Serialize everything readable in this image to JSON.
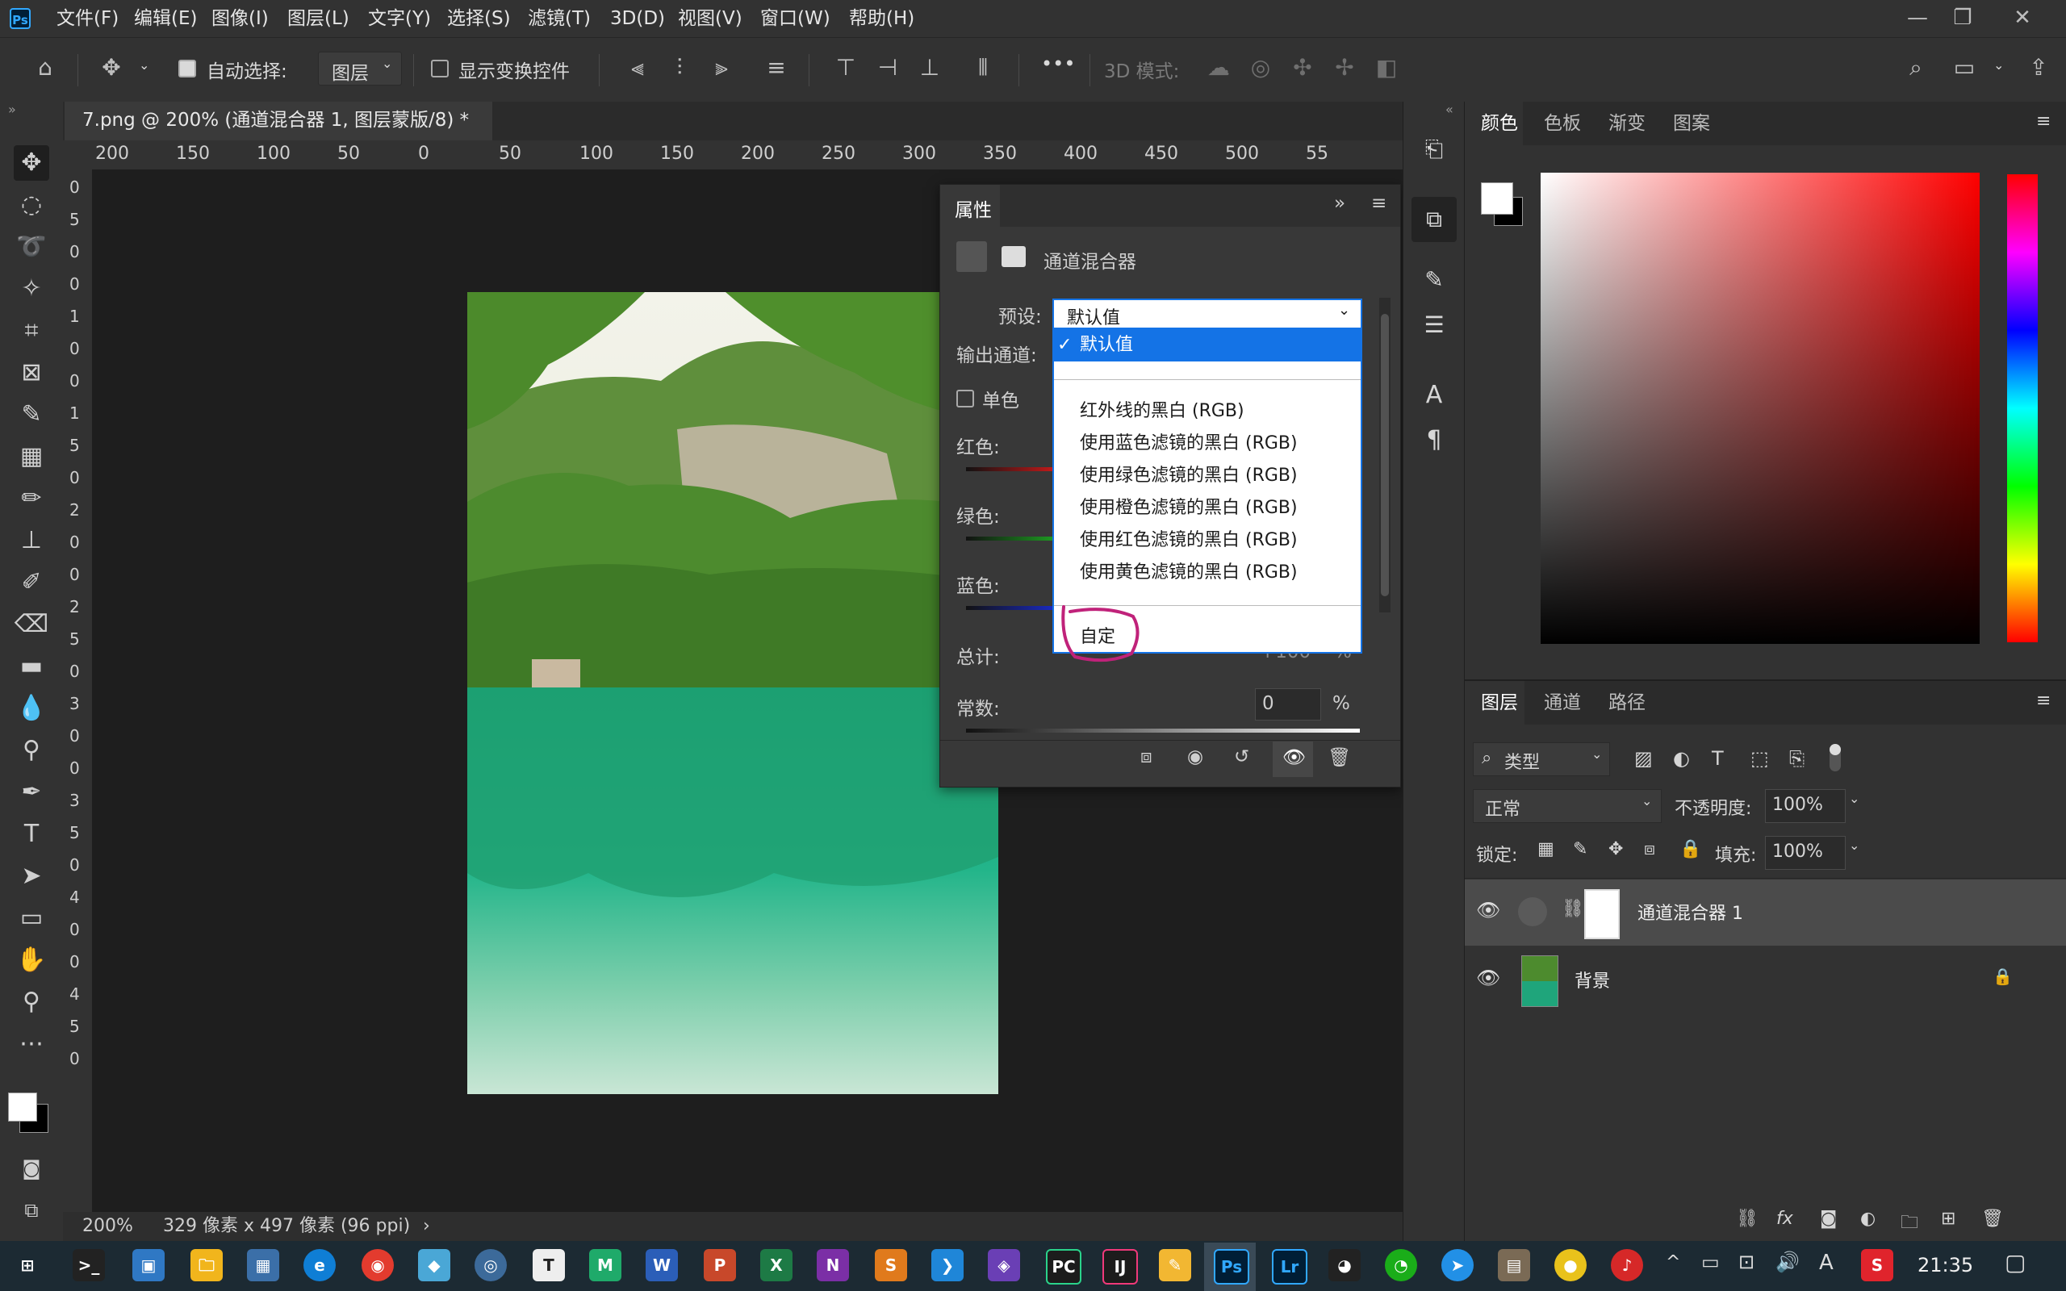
{
  "app": {
    "logo": "Ps"
  },
  "menu": [
    "文件(F)",
    "编辑(E)",
    "图像(I)",
    "图层(L)",
    "文字(Y)",
    "选择(S)",
    "滤镜(T)",
    "3D(D)",
    "视图(V)",
    "窗口(W)",
    "帮助(H)"
  ],
  "window_controls": {
    "minimize": "—",
    "restore": "❐",
    "close": "✕"
  },
  "options_bar": {
    "auto_select_label": "自动选择:",
    "auto_select_target": "图层",
    "show_transform_label": "显示变换控件",
    "more": "•••",
    "mode_3d_label": "3D 模式:"
  },
  "document_tab": {
    "title": "7.png @ 200% (通道混合器 1, 图层蒙版/8) *",
    "close": "×"
  },
  "ruler_top": [
    "200",
    "150",
    "100",
    "50",
    "0",
    "50",
    "100",
    "150",
    "200",
    "250",
    "300",
    "350",
    "400",
    "450",
    "500",
    "55"
  ],
  "ruler_left": [
    "0",
    "5",
    "0",
    "0",
    "1",
    "0",
    "0",
    "1",
    "5",
    "0",
    "2",
    "0",
    "0",
    "2",
    "5",
    "0",
    "3",
    "0",
    "0",
    "3",
    "5",
    "0",
    "4",
    "0",
    "0",
    "4",
    "5",
    "0"
  ],
  "status": {
    "zoom": "200%",
    "info": "329 像素 x 497 像素 (96 ppi)",
    "arrow": "›"
  },
  "properties": {
    "tab": "属性",
    "title": "通道混合器",
    "preset_label": "预设:",
    "preset_value": "默认值",
    "output_label": "输出通道:",
    "mono_label": "单色",
    "red_label": "红色:",
    "green_label": "绿色:",
    "blue_label": "蓝色:",
    "total_label": "总计:",
    "total_value": "+100",
    "total_unit": "%",
    "constant_label": "常数:",
    "constant_value": "0",
    "constant_unit": "%"
  },
  "dropdown": {
    "checkmark": "✓",
    "selected": "默认值",
    "options": [
      "红外线的黑白 (RGB)",
      "使用蓝色滤镜的黑白 (RGB)",
      "使用绿色滤镜的黑白 (RGB)",
      "使用橙色滤镜的黑白 (RGB)",
      "使用红色滤镜的黑白 (RGB)",
      "使用黄色滤镜的黑白 (RGB)"
    ],
    "custom": "自定"
  },
  "color_panel": {
    "tabs": [
      "颜色",
      "色板",
      "渐变",
      "图案"
    ]
  },
  "layers_panel": {
    "tabs": [
      "图层",
      "通道",
      "路径"
    ],
    "filter_kind": "类型",
    "blend_mode": "正常",
    "opacity_label": "不透明度:",
    "opacity_value": "100%",
    "lock_label": "锁定:",
    "fill_label": "填充:",
    "fill_value": "100%",
    "layers": [
      {
        "name": "通道混合器 1"
      },
      {
        "name": "背景"
      }
    ]
  },
  "taskbar": {
    "time": "21:35",
    "ime": "A"
  },
  "colors": {
    "accent": "#1473e6",
    "annotation": "#c0227a",
    "swatch_fg": "#ffffff",
    "swatch_bg": "#000000"
  }
}
